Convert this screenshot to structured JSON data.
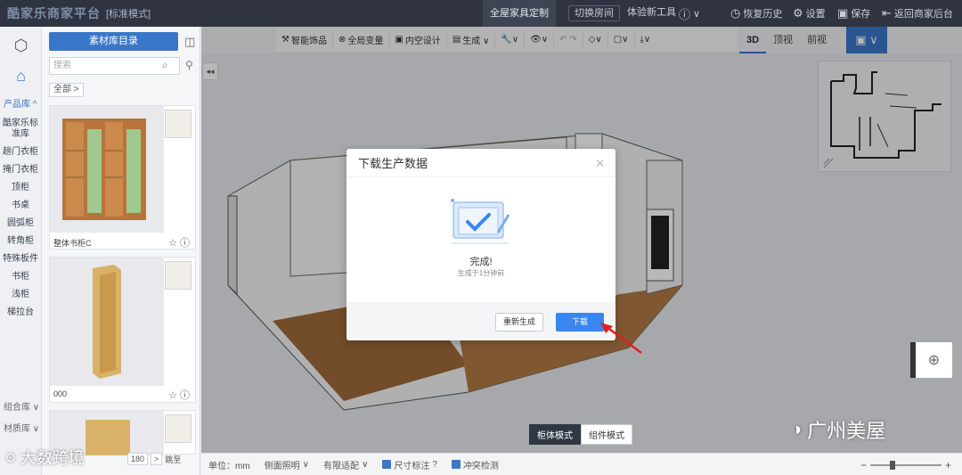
{
  "app": {
    "brand": "酷家乐商家平台",
    "mode": "[标准模式]"
  },
  "topbar": {
    "tab_active": "全屋家具定制",
    "switch_room": "切换房间",
    "experience": "体验新工具",
    "help": "?",
    "history": "恢复历史",
    "settings": "设置",
    "save": "保存",
    "back": "返回商家后台"
  },
  "rail": {
    "section_product": "产品库 ^",
    "categories": [
      "酷家乐标准库",
      "趟门衣柜",
      "掩门衣柜",
      "顶柜",
      "书桌",
      "圆弧柜",
      "转角柜",
      "特殊板件",
      "书柜",
      "浅柜",
      "梯拉台"
    ],
    "section_combo": "组合库 ∨",
    "section_material": "材质库 ∨"
  },
  "library": {
    "catalog_button": "素材库目录",
    "search_placeholder": "搜索",
    "crumb": "全部 >",
    "items": [
      {
        "name": "整体书柜C"
      },
      {
        "name": "000"
      }
    ],
    "pager_page": "180",
    "pager_next": ">",
    "pager_go": "跳至"
  },
  "toolbar": {
    "items": [
      "智能饰品",
      "全局变量",
      "内空设计",
      "生成 ∨",
      "🔧∨",
      "👁∨",
      "↶ ↷",
      "◇∨",
      "▢∨",
      "⤓∨"
    ]
  },
  "view_tabs": [
    "3D",
    "顶视",
    "前视"
  ],
  "status": {
    "unit": "单位：mm",
    "side_light": "侧面照明",
    "align": "有限适配",
    "dim_mark": "尺寸标注",
    "collision": "冲突检测"
  },
  "bottom_mode": [
    "柜体模式",
    "组件模式"
  ],
  "modal": {
    "title": "下载生产数据",
    "done": "完成!",
    "sub": "生成于1分钟前",
    "regen": "重新生成",
    "download": "下载"
  },
  "watermarks": {
    "left": "大数跨境",
    "right": "广州美屋"
  },
  "colors": {
    "accent": "#3a77c8",
    "download": "#3a86f0",
    "arrow": "#e02020"
  }
}
